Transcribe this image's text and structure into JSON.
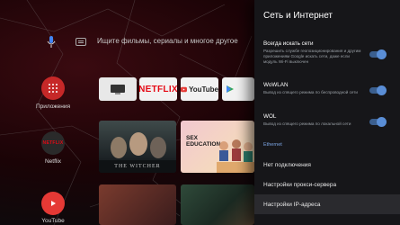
{
  "search": {
    "placeholder": "Ищите фильмы, сериалы и многое другое"
  },
  "apps": [
    {
      "label": "Приложения"
    },
    {
      "label": "Netflix",
      "logo": "NETFLIX"
    },
    {
      "label": "YouTube"
    }
  ],
  "channels": {
    "netflix_logo": "NETFLIX",
    "youtube_logo": "YouTube"
  },
  "content": {
    "witcher_text": "THE WITCHER",
    "sex_education_text": "SEX EDUCATION"
  },
  "panel": {
    "title": "Сеть и Интернет",
    "options": [
      {
        "title": "Всегда искать сети",
        "desc": "Разрешить службе геопозиционирования и другим приложениям Google искать сети, даже если модуль Wi-Fi выключен",
        "enabled": true
      },
      {
        "title": "WoWLAN",
        "desc": "Вывод из спящего режима по беспроводной сети",
        "enabled": true
      },
      {
        "title": "WOL",
        "desc": "Вывод из спящего режима по локальной сети",
        "enabled": true
      }
    ],
    "section": "Ethernet",
    "items": [
      {
        "label": "Нет подключения"
      },
      {
        "label": "Настройки прокси-сервера"
      },
      {
        "label": "Настройки IP-адреса"
      }
    ]
  },
  "colors": {
    "accent": "#5a8ed6",
    "netflix_red": "#e50914",
    "panel_bg": "#161619"
  }
}
